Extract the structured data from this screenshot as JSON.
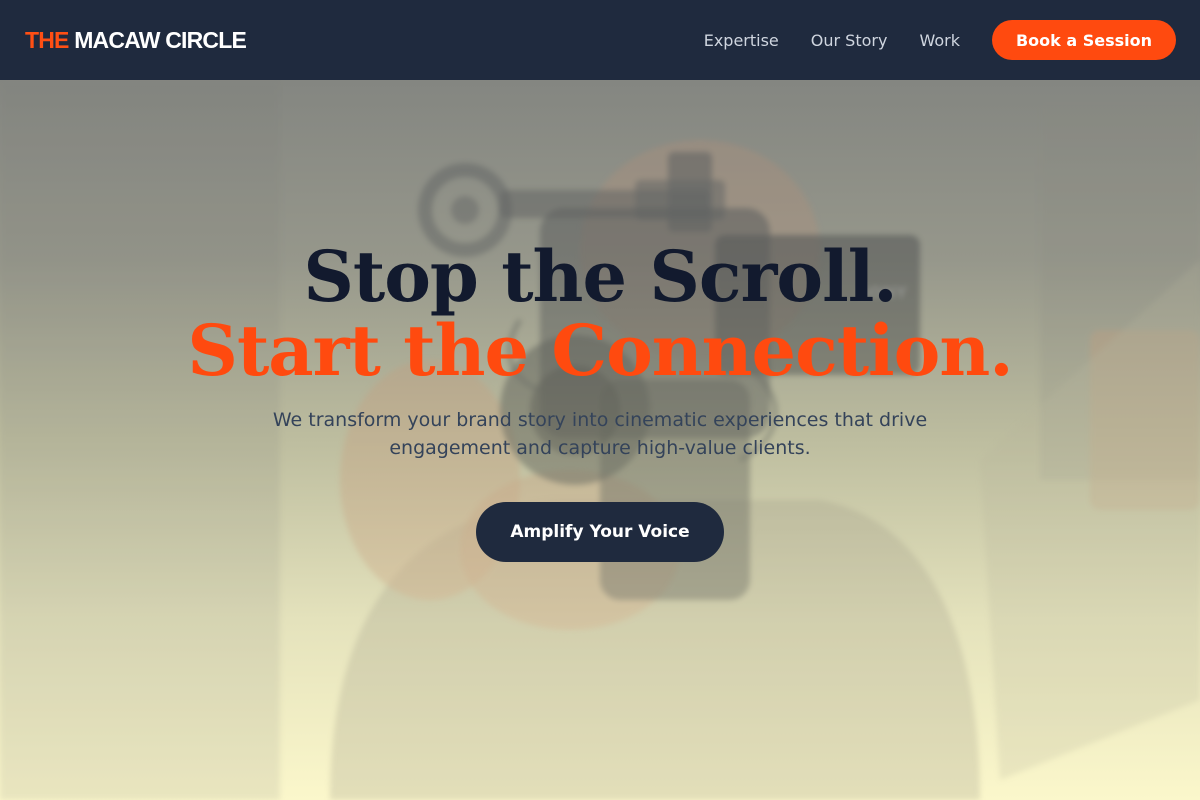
{
  "nav": {
    "logo_accent": "THE",
    "logo_rest": "MACAW CIRCLE",
    "links": [
      "Expertise",
      "Our Story",
      "Work"
    ],
    "cta_label": "Book a Session"
  },
  "hero": {
    "headline_line1": "Stop the Scroll.",
    "headline_line2": "Start the Connection.",
    "subtitle": "We transform your brand story into cinematic experiences that drive engagement and capture high-value clients.",
    "cta_label": "Amplify Your Voice",
    "background_image": "blurred-camera-operator-photo"
  },
  "colors": {
    "navbar_bg": "#1f2a3e",
    "accent_orange": "#ff4a0f",
    "headline_dark": "#121a2e",
    "body_text": "#34435a",
    "hero_gradient_bottom": "#fbf7cb"
  }
}
